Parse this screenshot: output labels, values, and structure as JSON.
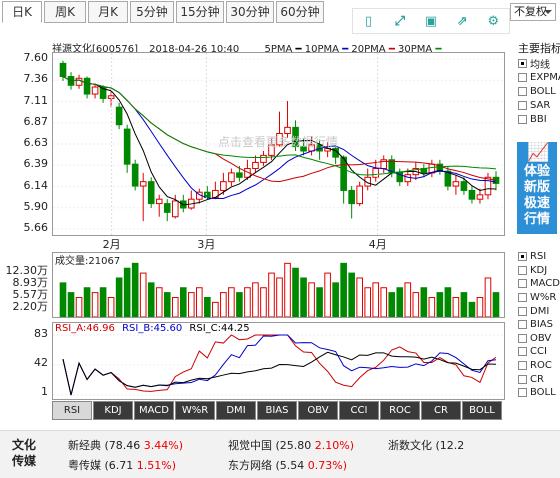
{
  "tabs": [
    {
      "label": "日K",
      "active": true
    },
    {
      "label": "周K",
      "active": false
    },
    {
      "label": "月K",
      "active": false
    },
    {
      "label": "5分钟",
      "active": false
    },
    {
      "label": "15分钟",
      "active": false
    },
    {
      "label": "30分钟",
      "active": false
    },
    {
      "label": "60分钟",
      "active": false
    }
  ],
  "toolbar": {
    "icons": [
      "phone-icon",
      "fullscreen-icon",
      "save-icon",
      "share-icon",
      "settings-icon"
    ],
    "adjust_select": "不复权"
  },
  "header": {
    "stock": "祥源文化[600576]",
    "datetime": "2018-04-26  10:40",
    "ma5": "5PMA",
    "ma10": "10PMA",
    "ma20": "20PMA",
    "ma30": "30PMA"
  },
  "colors": {
    "up": "#e00000",
    "down": "#008800",
    "ma5": "#000000",
    "ma10": "#0000cc",
    "ma20": "#cc0000",
    "ma30": "#008800",
    "rsi_a": "#cc0000",
    "rsi_b": "#0000cc",
    "rsi_c": "#000000"
  },
  "price_axis": [
    "7.60",
    "7.36",
    "7.11",
    "6.87",
    "6.63",
    "6.39",
    "6.14",
    "5.90",
    "5.66"
  ],
  "months": [
    "2月",
    "3月",
    "4月"
  ],
  "watermark": "点击查看更多数据行情",
  "main_index": {
    "title": "主要指标",
    "items": [
      {
        "label": "均线",
        "checked": true
      },
      {
        "label": "EXPMA",
        "checked": false
      },
      {
        "label": "BOLL",
        "checked": false
      },
      {
        "label": "SAR",
        "checked": false
      },
      {
        "label": "BBI",
        "checked": false
      }
    ]
  },
  "promo": {
    "line1": "体验",
    "line2": "新版",
    "line3": "极速",
    "line4": "行情"
  },
  "volume": {
    "label": "成交量:21067",
    "axis": [
      "12.30万",
      "8.93万",
      "5.57万",
      "2.20万"
    ]
  },
  "rsi": {
    "a": "RSI_A:46.96",
    "b": "RSI_B:45.60",
    "c": "RSI_C:44.25",
    "axis": [
      "83",
      "42",
      "1"
    ]
  },
  "indicator_side": [
    {
      "label": "RSI",
      "checked": true
    },
    {
      "label": "KDJ",
      "checked": false
    },
    {
      "label": "MACD",
      "checked": false
    },
    {
      "label": "W%R",
      "checked": false
    },
    {
      "label": "DMI",
      "checked": false
    },
    {
      "label": "BIAS",
      "checked": false
    },
    {
      "label": "OBV",
      "checked": false
    },
    {
      "label": "CCI",
      "checked": false
    },
    {
      "label": "ROC",
      "checked": false
    },
    {
      "label": "CR",
      "checked": false
    },
    {
      "label": "BOLL",
      "checked": false
    }
  ],
  "bottom_tabs": [
    "RSI",
    "KDJ",
    "MACD",
    "W%R",
    "DMI",
    "BIAS",
    "OBV",
    "CCI",
    "ROC",
    "CR",
    "BOLL"
  ],
  "footer": {
    "section": "文化传媒",
    "stocks": [
      {
        "name": "新经典",
        "price": "(78.46",
        "change": "3.44%)"
      },
      {
        "name": "视觉中国",
        "price": "(25.80",
        "change": "2.10%)"
      },
      {
        "name": "浙数文化",
        "price": "(12.2",
        "change": ""
      },
      {
        "name": "粤传媒",
        "price": "(6.71",
        "change": "1.51%)"
      },
      {
        "name": "东方网络",
        "price": "(5.54",
        "change": "0.73%)"
      }
    ]
  },
  "chart_data": {
    "type": "candlestick",
    "price_range": [
      5.66,
      7.6
    ],
    "candles": [
      [
        7.55,
        7.4,
        7.58,
        7.35
      ],
      [
        7.4,
        7.3,
        7.45,
        7.25
      ],
      [
        7.3,
        7.38,
        7.42,
        7.26
      ],
      [
        7.38,
        7.2,
        7.4,
        7.15
      ],
      [
        7.2,
        7.28,
        7.32,
        7.15
      ],
      [
        7.28,
        7.15,
        7.3,
        7.1
      ],
      [
        7.15,
        7.18,
        7.25,
        7.05
      ],
      [
        7.05,
        6.85,
        7.1,
        6.8
      ],
      [
        6.8,
        6.4,
        6.85,
        6.3
      ],
      [
        6.4,
        6.15,
        6.45,
        6.1
      ],
      [
        6.15,
        6.2,
        6.3,
        5.75
      ],
      [
        6.2,
        5.95,
        6.25,
        5.9
      ],
      [
        5.95,
        6.0,
        6.05,
        5.8
      ],
      [
        5.95,
        5.85,
        6.0,
        5.75
      ],
      [
        5.8,
        5.98,
        6.05,
        5.78
      ],
      [
        5.98,
        5.9,
        6.05,
        5.85
      ],
      [
        5.9,
        6.0,
        6.1,
        5.88
      ],
      [
        6.0,
        6.08,
        6.12,
        5.95
      ],
      [
        6.08,
        6.02,
        6.15,
        6.0
      ],
      [
        6.02,
        6.1,
        6.2,
        6.0
      ],
      [
        6.1,
        6.2,
        6.3,
        6.05
      ],
      [
        6.2,
        6.3,
        6.35,
        6.15
      ],
      [
        6.3,
        6.25,
        6.38,
        6.2
      ],
      [
        6.25,
        6.35,
        6.45,
        6.22
      ],
      [
        6.35,
        6.42,
        6.5,
        6.3
      ],
      [
        6.42,
        6.5,
        6.55,
        6.38
      ],
      [
        6.5,
        6.62,
        6.7,
        6.45
      ],
      [
        6.62,
        6.75,
        7.0,
        6.6
      ],
      [
        6.75,
        6.82,
        7.12,
        6.7
      ],
      [
        6.82,
        6.6,
        6.9,
        6.55
      ],
      [
        6.6,
        6.55,
        6.7,
        6.5
      ],
      [
        6.55,
        6.62,
        6.72,
        6.5
      ],
      [
        6.62,
        6.55,
        6.68,
        6.45
      ],
      [
        6.55,
        6.58,
        6.65,
        6.48
      ],
      [
        6.58,
        6.48,
        6.62,
        6.4
      ],
      [
        6.48,
        6.1,
        6.5,
        5.95
      ],
      [
        6.1,
        5.95,
        6.15,
        5.78
      ],
      [
        5.95,
        6.15,
        6.2,
        5.92
      ],
      [
        6.15,
        6.25,
        6.35,
        6.1
      ],
      [
        6.25,
        6.35,
        6.45,
        6.2
      ],
      [
        6.35,
        6.45,
        6.5,
        6.3
      ],
      [
        6.45,
        6.3,
        6.5,
        6.25
      ],
      [
        6.3,
        6.2,
        6.35,
        6.15
      ],
      [
        6.2,
        6.28,
        6.35,
        6.15
      ],
      [
        6.28,
        6.35,
        6.42,
        6.22
      ],
      [
        6.35,
        6.3,
        6.4,
        6.25
      ],
      [
        6.3,
        6.4,
        6.45,
        6.25
      ],
      [
        6.4,
        6.32,
        6.45,
        6.28
      ],
      [
        6.32,
        6.15,
        6.38,
        6.1
      ],
      [
        6.15,
        6.2,
        6.28,
        6.05
      ],
      [
        6.2,
        6.1,
        6.25,
        6.05
      ],
      [
        6.1,
        6.0,
        6.15,
        5.95
      ],
      [
        6.0,
        6.05,
        6.12,
        5.95
      ],
      [
        6.05,
        6.25,
        6.3,
        6.0
      ],
      [
        6.25,
        6.18,
        6.32,
        6.1
      ]
    ],
    "volumes": [
      7,
      5,
      4,
      6,
      5,
      6,
      4,
      8,
      10,
      11,
      9,
      7,
      6,
      5,
      4,
      6,
      5,
      6,
      4,
      3,
      5,
      6,
      5,
      6,
      7,
      6,
      9,
      8,
      11,
      10,
      8,
      7,
      6,
      9,
      7,
      11,
      9,
      8,
      6,
      7,
      6,
      5,
      6,
      7,
      5,
      6,
      4,
      5,
      6,
      4,
      5,
      3,
      4,
      8,
      5
    ],
    "volume_range": [
      0,
      12.3
    ],
    "rsi_range": [
      1,
      83
    ]
  }
}
